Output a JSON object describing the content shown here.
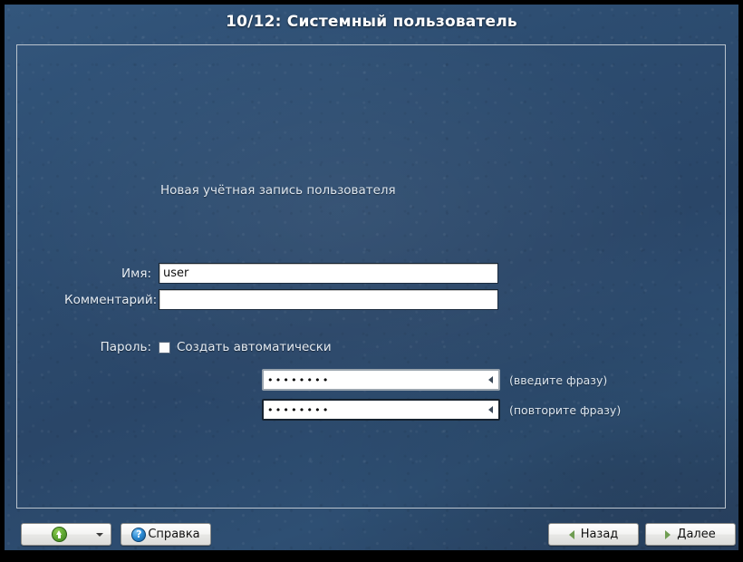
{
  "window": {
    "title": "10/12: Системный пользователь"
  },
  "form": {
    "heading": "Новая учётная запись пользователя",
    "fields": [
      {
        "label": "Имя:",
        "value": "user",
        "placeholder": ""
      },
      {
        "label": "Комментарий:",
        "value": "",
        "placeholder": ""
      }
    ],
    "password": {
      "label": "Пароль:",
      "auto_generate_label": "Создать автоматически",
      "auto_generate_checked": false,
      "entry": {
        "masked_value": "••••••••",
        "hint": "(введите фразу)"
      },
      "confirm": {
        "masked_value": "••••••••",
        "hint": "(повторите фразу)"
      }
    }
  },
  "footer": {
    "updown_label": "",
    "updown_icon": "green-up-arrow-icon",
    "updown_caret_icon": "chevron-down-icon",
    "help_label": "Справка",
    "help_icon": "question-mark-icon",
    "back_label": "Назад",
    "back_icon": "triangle-left-icon",
    "next_label": "Далее",
    "next_icon": "triangle-right-icon"
  },
  "colors": {
    "background": "#2b4a6e",
    "frame_border": "#b9c3cd",
    "accent_green": "#63ab35",
    "accent_blue": "#2f8fd8",
    "text_light": "#e6edf4"
  }
}
